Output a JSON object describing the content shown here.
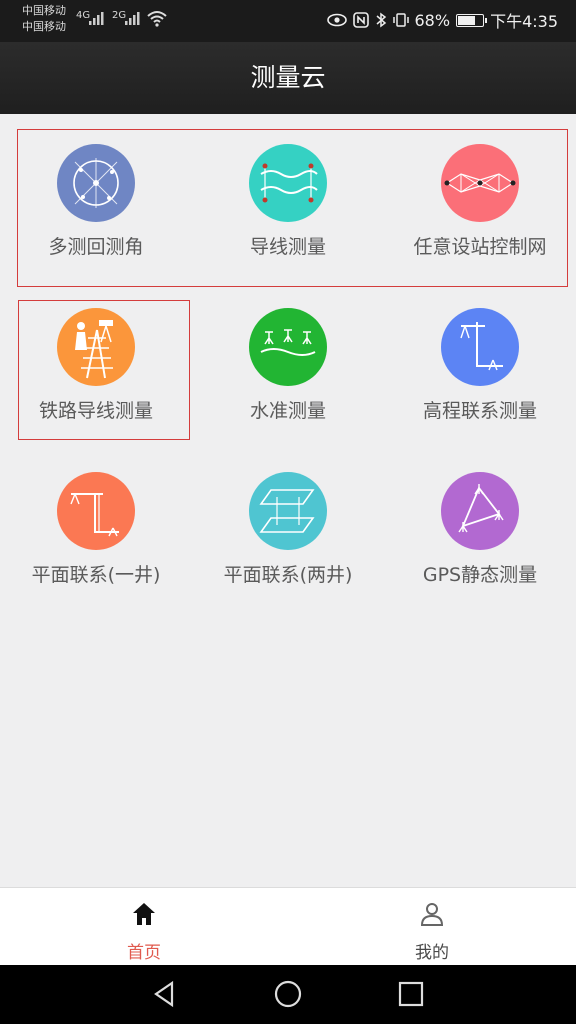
{
  "status": {
    "carrier1": "中国移动",
    "carrier2": "中国移动",
    "net1": "4G",
    "net2": "2G",
    "battery": "68%",
    "time": "下午4:35"
  },
  "title": "测量云",
  "items": [
    {
      "label": "多测回测角",
      "color": "#6f86c4",
      "icon": "angle-target-icon"
    },
    {
      "label": "导线测量",
      "color": "#35d1c3",
      "icon": "traverse-line-icon"
    },
    {
      "label": "任意设站控制网",
      "color": "#fb6f78",
      "icon": "control-network-icon"
    },
    {
      "label": "铁路导线测量",
      "color": "#fb963b",
      "icon": "railway-surveyor-icon"
    },
    {
      "label": "水准测量",
      "color": "#22b533",
      "icon": "leveling-icon"
    },
    {
      "label": "高程联系测量",
      "color": "#5c84f4",
      "icon": "elevation-link-icon"
    },
    {
      "label": "平面联系(一井)",
      "color": "#fb7853",
      "icon": "single-shaft-icon"
    },
    {
      "label": "平面联系(两井)",
      "color": "#4fc5d1",
      "icon": "double-shaft-icon"
    },
    {
      "label": "GPS静态测量",
      "color": "#b269d1",
      "icon": "gps-static-icon"
    }
  ],
  "nav": {
    "home_label": "首页",
    "mine_label": "我的",
    "active_color": "#e05a4e",
    "inactive_color": "#4a4a4a"
  }
}
